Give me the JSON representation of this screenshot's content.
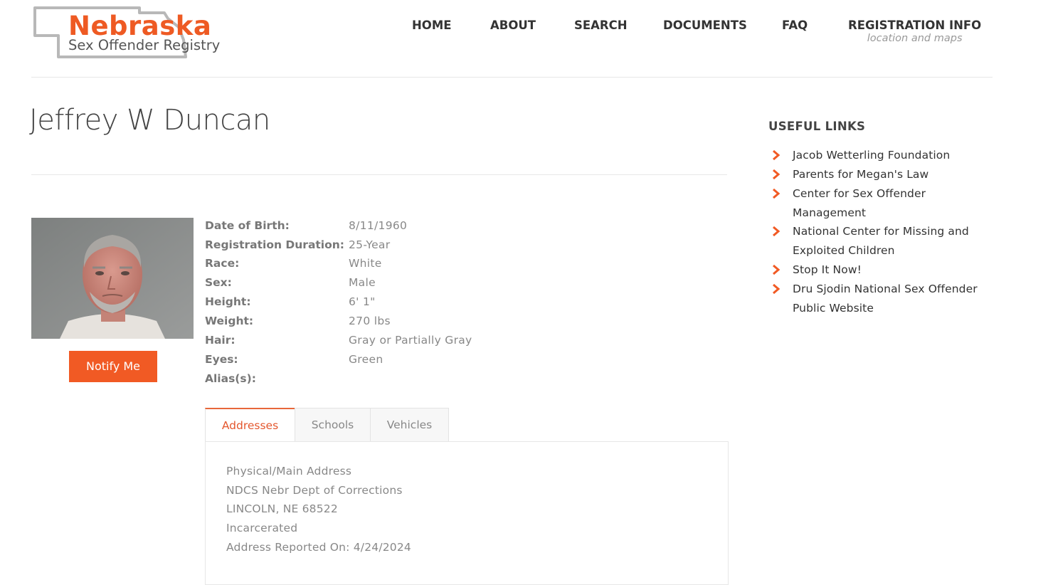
{
  "logo": {
    "title": "Nebraska",
    "subtitle": "Sex Offender Registry"
  },
  "nav": {
    "items": [
      {
        "label": "HOME"
      },
      {
        "label": "ABOUT"
      },
      {
        "label": "SEARCH"
      },
      {
        "label": "DOCUMENTS"
      },
      {
        "label": "FAQ"
      },
      {
        "label": "REGISTRATION INFO",
        "sub": "location and maps"
      }
    ]
  },
  "offender": {
    "name": "Jeffrey W Duncan",
    "notify_label": "Notify Me",
    "details": [
      {
        "label": "Date of Birth:",
        "value": "8/11/1960"
      },
      {
        "label": "Registration Duration:",
        "value": "25-Year"
      },
      {
        "label": "Race:",
        "value": "White"
      },
      {
        "label": "Sex:",
        "value": "Male"
      },
      {
        "label": "Height:",
        "value": "6' 1\""
      },
      {
        "label": "Weight:",
        "value": "270 lbs"
      },
      {
        "label": "Hair:",
        "value": "Gray or Partially Gray"
      },
      {
        "label": "Eyes:",
        "value": "Green"
      },
      {
        "label": "Alias(s):",
        "value": ""
      }
    ]
  },
  "tabs": [
    {
      "label": "Addresses",
      "active": true
    },
    {
      "label": "Schools",
      "active": false
    },
    {
      "label": "Vehicles",
      "active": false
    }
  ],
  "address": {
    "lines": [
      "Physical/Main Address",
      "NDCS Nebr Dept of Corrections",
      "LINCOLN, NE 68522",
      "Incarcerated",
      "Address Reported On: 4/24/2024"
    ]
  },
  "useful_links": {
    "title": "USEFUL LINKS",
    "items": [
      {
        "label": "Jacob Wetterling Foundation"
      },
      {
        "label": "Parents for Megan's Law"
      },
      {
        "label": "Center for Sex Offender Management"
      },
      {
        "label": "National Center for Missing and Exploited Children"
      },
      {
        "label": "Stop It Now!"
      },
      {
        "label": "Dru Sjodin National Sex Offender Public Website"
      }
    ]
  },
  "colors": {
    "accent": "#f15a24",
    "tab_active": "#e4572e",
    "text_dark": "#333333",
    "text_muted": "#888888"
  }
}
